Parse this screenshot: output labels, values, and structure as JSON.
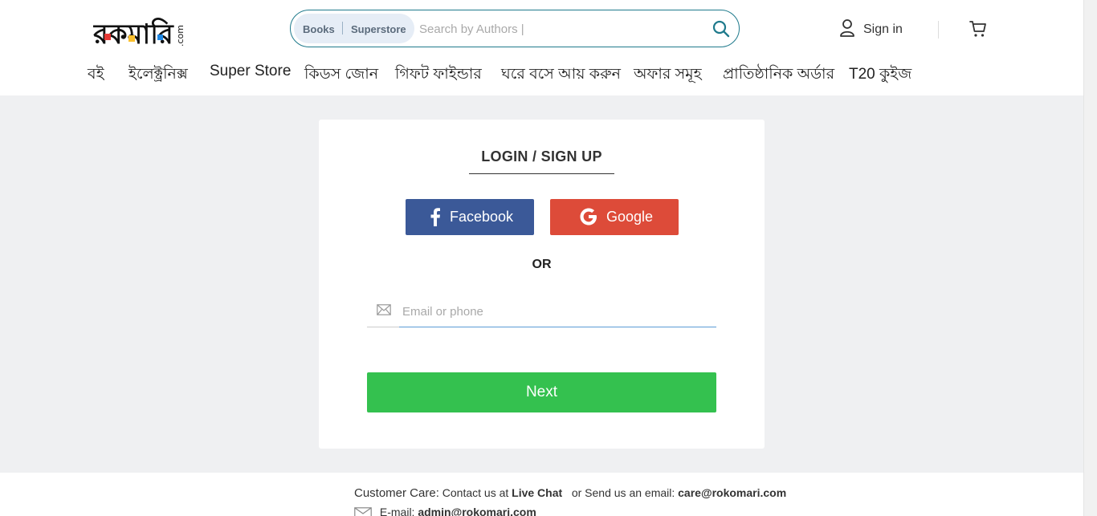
{
  "brand": {
    "logo_text": "রকমারি",
    "logo_suffix": ".com"
  },
  "search": {
    "tabs": [
      "Books",
      "Superstore"
    ],
    "placeholder": "Search by Authors |"
  },
  "header": {
    "signin_label": "Sign in"
  },
  "nav": {
    "items": [
      "বই",
      "ইলেক্ট্রনিক্স",
      "Super Store",
      "কিডস জোন",
      "গিফট ফাইন্ডার",
      "ঘরে বসে আয় করুন",
      "অফার সমূহ",
      "প্রাতিষ্ঠানিক অর্ডার",
      "T20 কুইজ"
    ]
  },
  "login": {
    "title": "LOGIN / SIGN UP",
    "facebook_label": "Facebook",
    "google_label": "Google",
    "or_label": "OR",
    "email_placeholder": "Email or phone",
    "next_label": "Next"
  },
  "footer": {
    "care_label": "Customer  Care:",
    "contact_text": "Contact us at",
    "live_chat": "Live Chat",
    "send_text": "or Send us an email:",
    "care_email": "care@rokomari.com",
    "email_label": "E-mail:",
    "admin_email": "admin@rokomari.com"
  },
  "colors": {
    "facebook": "#3b5998",
    "google": "#dd4b39",
    "next": "#34c14f",
    "search_border": "#1f7a8c",
    "page_bg": "#eff0f2"
  },
  "icons": [
    "search-icon",
    "user-icon",
    "cart-icon",
    "facebook-icon",
    "google-icon",
    "mail-icon"
  ]
}
